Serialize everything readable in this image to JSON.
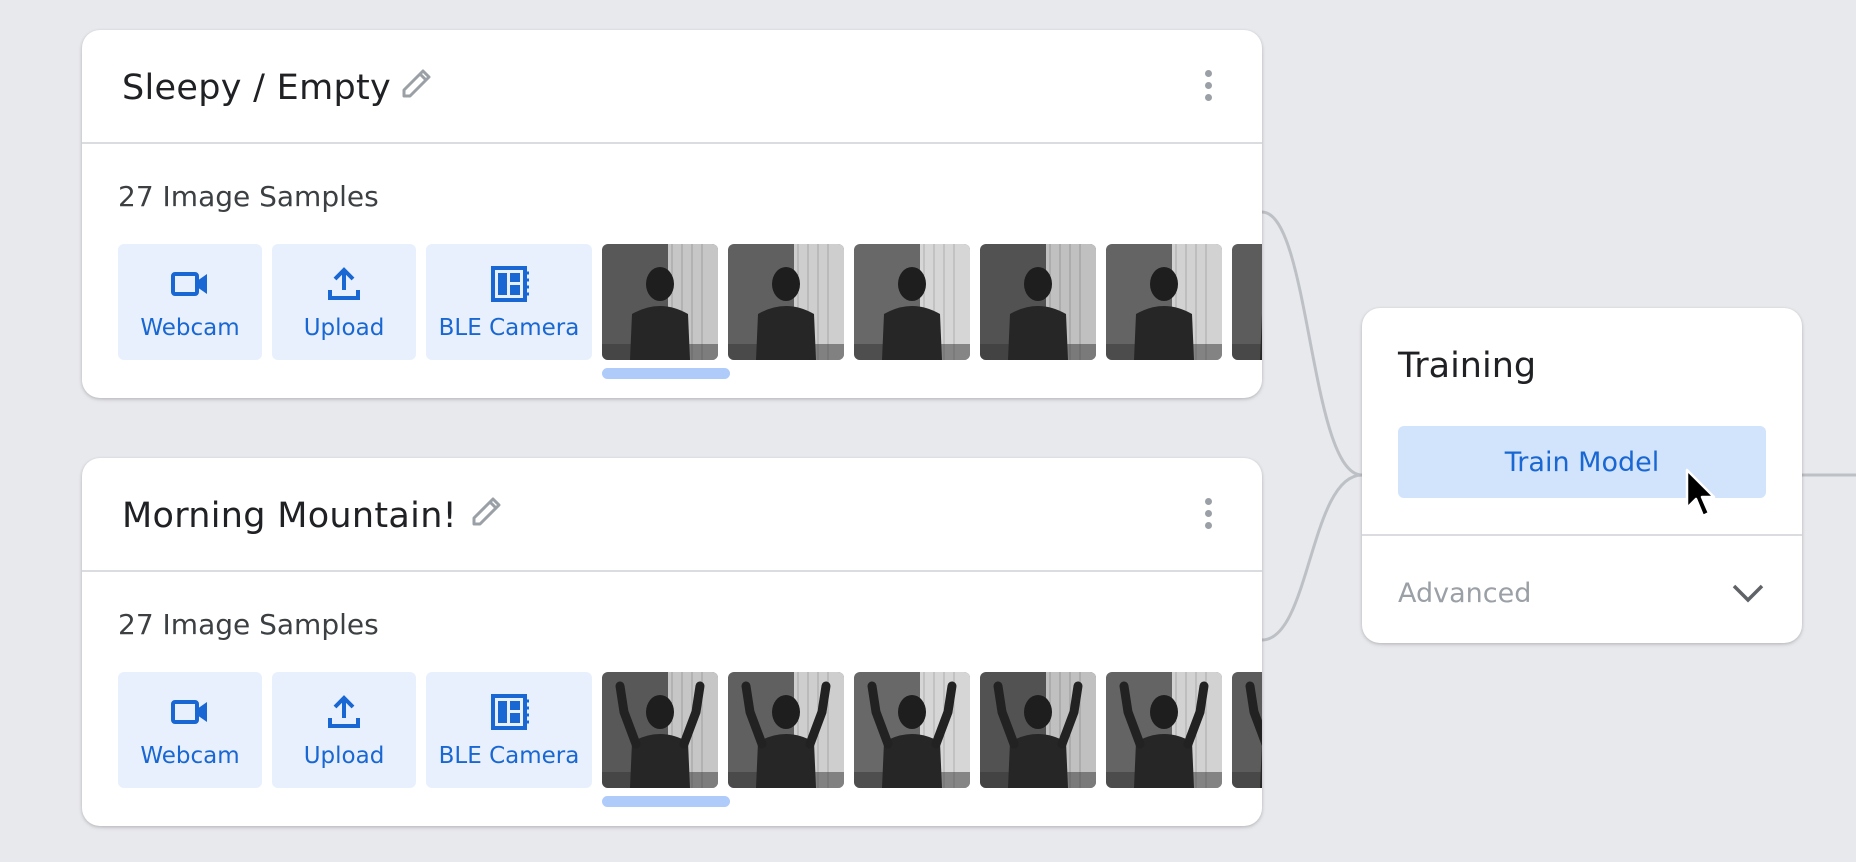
{
  "classes": [
    {
      "name": "Sleepy / Empty",
      "samples_label": "27 Image Samples",
      "sources": [
        "Webcam",
        "Upload",
        "BLE Camera"
      ],
      "pose": "arms-down"
    },
    {
      "name": "Morning Mountain!",
      "samples_label": "27 Image Samples",
      "sources": [
        "Webcam",
        "Upload",
        "BLE Camera"
      ],
      "pose": "arms-up"
    }
  ],
  "training": {
    "title": "Training",
    "train_button": "Train Model",
    "advanced_label": "Advanced"
  },
  "icons": {
    "webcam": "webcam-icon",
    "upload": "upload-icon",
    "ble": "ble-camera-icon",
    "edit": "pencil-icon",
    "menu": "more-vert-icon",
    "expand": "chevron-down-icon"
  },
  "colors": {
    "accent": "#1967d2",
    "button_bg": "#e8f0fe",
    "train_button_bg": "#d2e3fc",
    "background": "#e8e9ed"
  }
}
